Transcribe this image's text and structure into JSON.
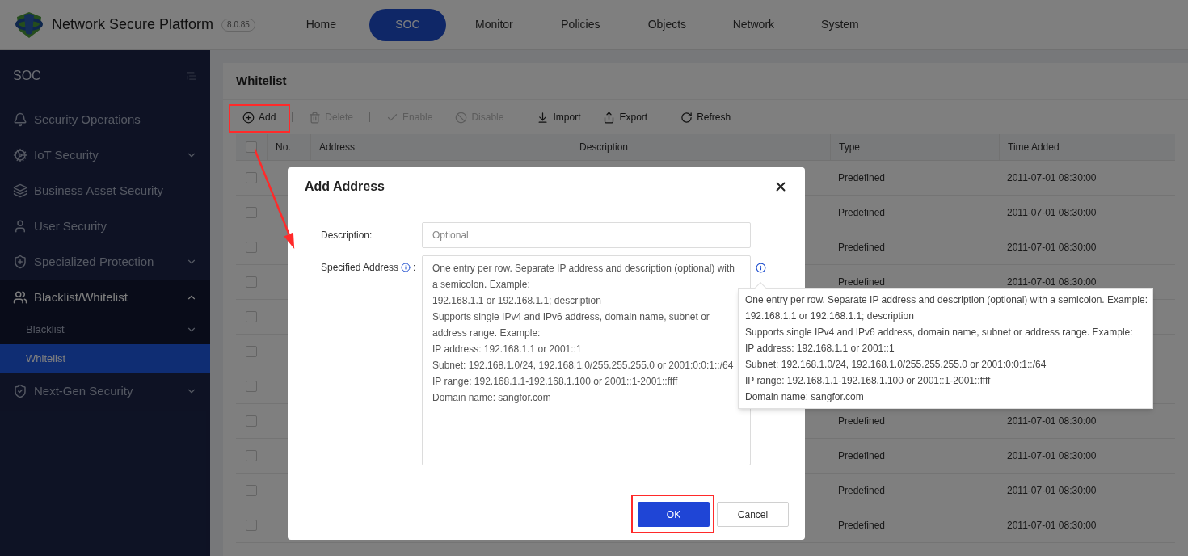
{
  "header": {
    "product": "Network Secure Platform",
    "version": "8.0.85",
    "nav": [
      {
        "label": "Home",
        "selected": false
      },
      {
        "label": "SOC",
        "selected": true
      },
      {
        "label": "Monitor",
        "selected": false
      },
      {
        "label": "Policies",
        "selected": false
      },
      {
        "label": "Objects",
        "selected": false
      },
      {
        "label": "Network",
        "selected": false
      },
      {
        "label": "System",
        "selected": false
      }
    ]
  },
  "sidebar": {
    "title": "SOC",
    "items": [
      {
        "label": "Security Operations",
        "kind": "link"
      },
      {
        "label": "IoT Security",
        "kind": "group",
        "expanded": false
      },
      {
        "label": "Business Asset Security",
        "kind": "link"
      },
      {
        "label": "User Security",
        "kind": "link"
      },
      {
        "label": "Specialized Protection",
        "kind": "group",
        "expanded": false
      },
      {
        "label": "Blacklist/Whitelist",
        "kind": "group",
        "expanded": true,
        "children": [
          {
            "label": "Blacklist",
            "kind": "group",
            "expanded": false,
            "selected": false
          },
          {
            "label": "Whitelist",
            "kind": "link",
            "selected": true
          }
        ]
      },
      {
        "label": "Next-Gen Security",
        "kind": "group",
        "expanded": false
      }
    ]
  },
  "page": {
    "title": "Whitelist",
    "toolbar": [
      [
        {
          "label": "Add",
          "disabled": false
        }
      ],
      [
        {
          "label": "Delete",
          "disabled": true
        }
      ],
      [
        {
          "label": "Enable",
          "disabled": true
        },
        {
          "label": "Disable",
          "disabled": true
        }
      ],
      [
        {
          "label": "Import",
          "disabled": false
        },
        {
          "label": "Export",
          "disabled": false
        }
      ],
      [
        {
          "label": "Refresh",
          "disabled": false
        }
      ]
    ],
    "table": {
      "all_checked": false,
      "columns": [
        "No.",
        "Address",
        "Description",
        "Type",
        "Time Added"
      ],
      "rows": [
        {
          "checked": false,
          "type": "Predefined",
          "time_added": "2011-07-01 08:30:00"
        },
        {
          "checked": false,
          "type": "Predefined",
          "time_added": "2011-07-01 08:30:00"
        },
        {
          "checked": false,
          "type": "Predefined",
          "time_added": "2011-07-01 08:30:00"
        },
        {
          "checked": false,
          "type": "Predefined",
          "time_added": "2011-07-01 08:30:00"
        },
        {
          "checked": false
        },
        {
          "checked": false
        },
        {
          "checked": false
        },
        {
          "checked": false,
          "type": "Predefined",
          "time_added": "2011-07-01 08:30:00"
        },
        {
          "checked": false,
          "type": "Predefined",
          "time_added": "2011-07-01 08:30:00"
        },
        {
          "checked": false,
          "type": "Predefined",
          "time_added": "2011-07-01 08:30:00"
        },
        {
          "checked": false,
          "type": "Predefined",
          "time_added": "2011-07-01 08:30:00"
        }
      ]
    }
  },
  "dialog": {
    "title": "Add Address",
    "description": {
      "label": "Description:",
      "placeholder": "Optional"
    },
    "address": {
      "label": "Specified Address",
      "colon": ":",
      "value": [
        "One entry per row. Separate IP address and description (optional) with a semicolon. Example:",
        "192.168.1.1 or 192.168.1.1; description",
        "Supports single IPv4 and IPv6 address, domain name, subnet or address range. Example:",
        "IP address: 192.168.1.1 or 2001::1",
        "Subnet: 192.168.1.0/24, 192.168.1.0/255.255.255.0 or 2001:0:0:1::/64",
        "IP range: 192.168.1.1-192.168.1.100 or 2001::1-2001::ffff",
        "Domain name: sangfor.com"
      ]
    },
    "tooltip": [
      "One entry per row. Separate IP address and description (optional) with a semicolon. Example:",
      "192.168.1.1 or 192.168.1.1; description",
      "Supports single IPv4 and IPv6 address, domain name, subnet or address range. Example:",
      "IP address: 192.168.1.1 or 2001::1",
      "Subnet: 192.168.1.0/24, 192.168.1.0/255.255.255.0 or 2001:0:0:1::/64",
      "IP range: 192.168.1.1-192.168.1.100 or 2001::1-2001::ffff",
      "Domain name: sangfor.com"
    ],
    "buttons": [
      {
        "label": "OK",
        "kind": "primary"
      },
      {
        "label": "Cancel",
        "kind": "secondary"
      }
    ]
  }
}
